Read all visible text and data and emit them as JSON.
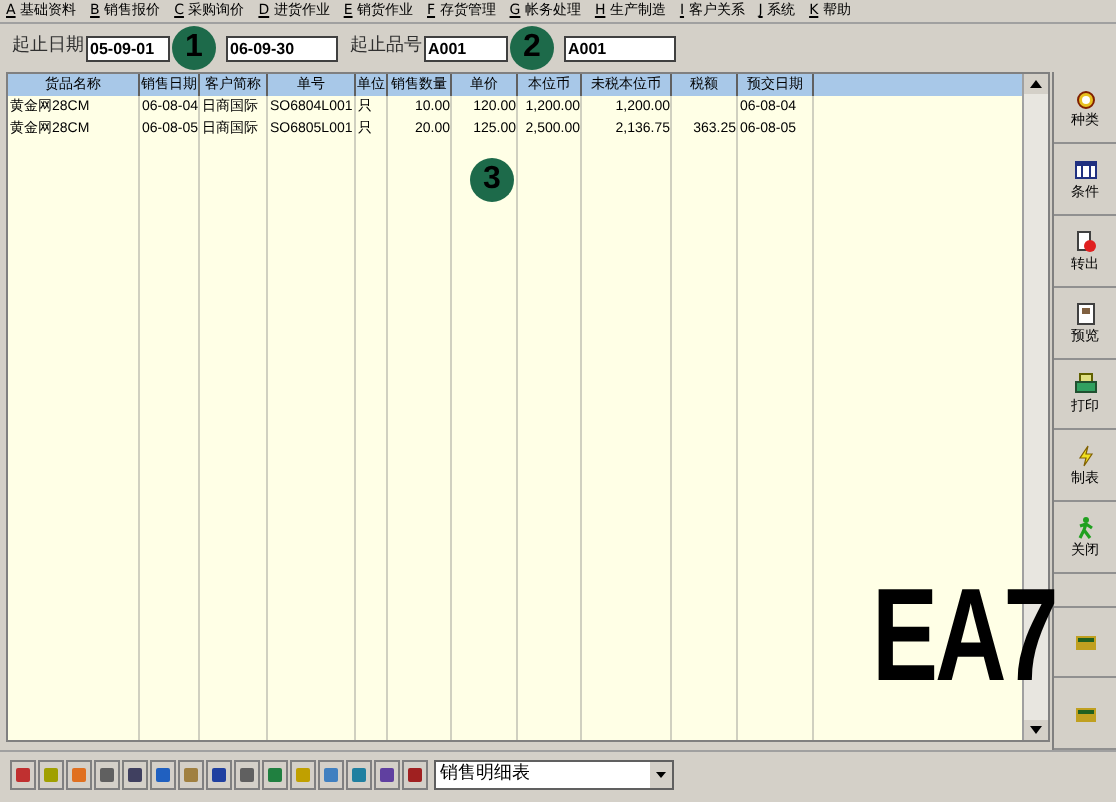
{
  "menu": [
    {
      "key": "A",
      "label": "基础资料"
    },
    {
      "key": "B",
      "label": "销售报价"
    },
    {
      "key": "C",
      "label": "采购询价"
    },
    {
      "key": "D",
      "label": "进货作业"
    },
    {
      "key": "E",
      "label": "销货作业"
    },
    {
      "key": "F",
      "label": "存货管理"
    },
    {
      "key": "G",
      "label": "帐务处理"
    },
    {
      "key": "H",
      "label": "生产制造"
    },
    {
      "key": "I",
      "label": "客户关系"
    },
    {
      "key": "J",
      "label": "系统"
    },
    {
      "key": "K",
      "label": "帮助"
    }
  ],
  "filters": [
    {
      "label": "起止日期",
      "from": "05-09-01",
      "to": "06-09-30"
    },
    {
      "label": "起止品号",
      "from": "A001",
      "to": "A001"
    }
  ],
  "table": {
    "columns": [
      {
        "label": "货品名称",
        "kind": "text"
      },
      {
        "label": "销售日期",
        "kind": "text"
      },
      {
        "label": "客户简称",
        "kind": "text"
      },
      {
        "label": "单号",
        "kind": "text"
      },
      {
        "label": "单位",
        "kind": "text"
      },
      {
        "label": "销售数量",
        "kind": "number"
      },
      {
        "label": "单价",
        "kind": "number"
      },
      {
        "label": "本位币",
        "kind": "number"
      },
      {
        "label": "未税本位币",
        "kind": "number"
      },
      {
        "label": "税额",
        "kind": "number"
      },
      {
        "label": "预交日期",
        "kind": "text"
      }
    ],
    "rows": [
      [
        "黄金网28CM",
        "06-08-04",
        "日商国际",
        "SO6804L001",
        "只",
        "10.00",
        "120.00",
        "1,200.00",
        "1,200.00",
        null,
        "06-08-04"
      ],
      [
        "黄金网28CM",
        "06-08-05",
        "日商国际",
        "SO6805L001",
        "只",
        "20.00",
        "125.00",
        "2,500.00",
        "2,136.75",
        "363.25",
        "06-08-05"
      ]
    ]
  },
  "side_buttons": [
    {
      "label": "种类",
      "kind": "alarm"
    },
    {
      "label": "条件",
      "kind": "grid"
    },
    {
      "label": "转出",
      "kind": "export"
    },
    {
      "label": "预览",
      "kind": "page"
    },
    {
      "label": "打印",
      "kind": "printer"
    },
    {
      "label": "制表",
      "kind": "bolt"
    },
    {
      "label": "关闭",
      "kind": "runner"
    }
  ],
  "report_select": {
    "value": "销售明细表"
  },
  "markers": [
    "1",
    "2",
    "3"
  ],
  "caption": "EA7"
}
